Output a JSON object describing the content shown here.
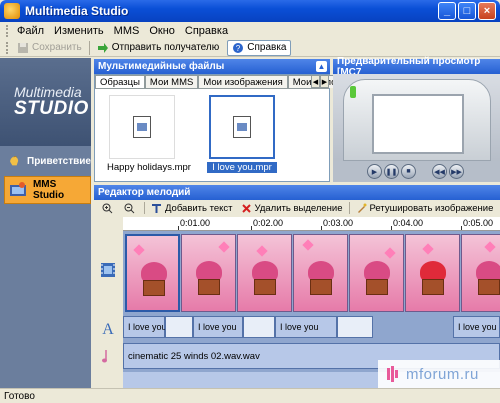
{
  "window": {
    "title": "Multimedia Studio",
    "min": "_",
    "max": "□",
    "close": "×"
  },
  "menu": [
    "Файл",
    "Изменить",
    "MMS",
    "Окно",
    "Справка"
  ],
  "toolbar": {
    "save": "Сохранить",
    "send": "Отправить получателю",
    "help": "Справка"
  },
  "nav": {
    "logo_line1": "Multimedia",
    "logo_line2": "STUDIO",
    "items": [
      {
        "label": "Приветствие"
      },
      {
        "label": "MMS Studio",
        "active": true
      }
    ]
  },
  "files_panel": {
    "title": "Мультимедийные файлы",
    "tabs": [
      "Образцы",
      "Мои MMS",
      "Мои изображения",
      "Мои мелоди"
    ],
    "files": [
      {
        "name": "Happy holidays.mpr",
        "selected": false
      },
      {
        "name": "I love you.mpr",
        "selected": true
      }
    ]
  },
  "preview": {
    "title": "Предварительный просмотр [MC7"
  },
  "editor": {
    "title": "Редактор мелодий",
    "toolbar": {
      "add_text": "Добавить текст",
      "delete": "Удалить выделение",
      "retouch": "Ретушировать изображение"
    },
    "ruler": [
      "0:01.00",
      "0:02.00",
      "0:03.00",
      "0:04.00",
      "0:05.00"
    ],
    "text_clips": [
      "I love you",
      "I love you",
      "I love you",
      "I love you"
    ],
    "audio_clip": "cinematic 25 winds 02.wav.wav"
  },
  "watermark": "mforum.ru",
  "status": "Готово",
  "colors": {
    "header_blue": "#2660d2",
    "nav_active": "#f6a836",
    "track_bg": "#8fa6ce"
  }
}
